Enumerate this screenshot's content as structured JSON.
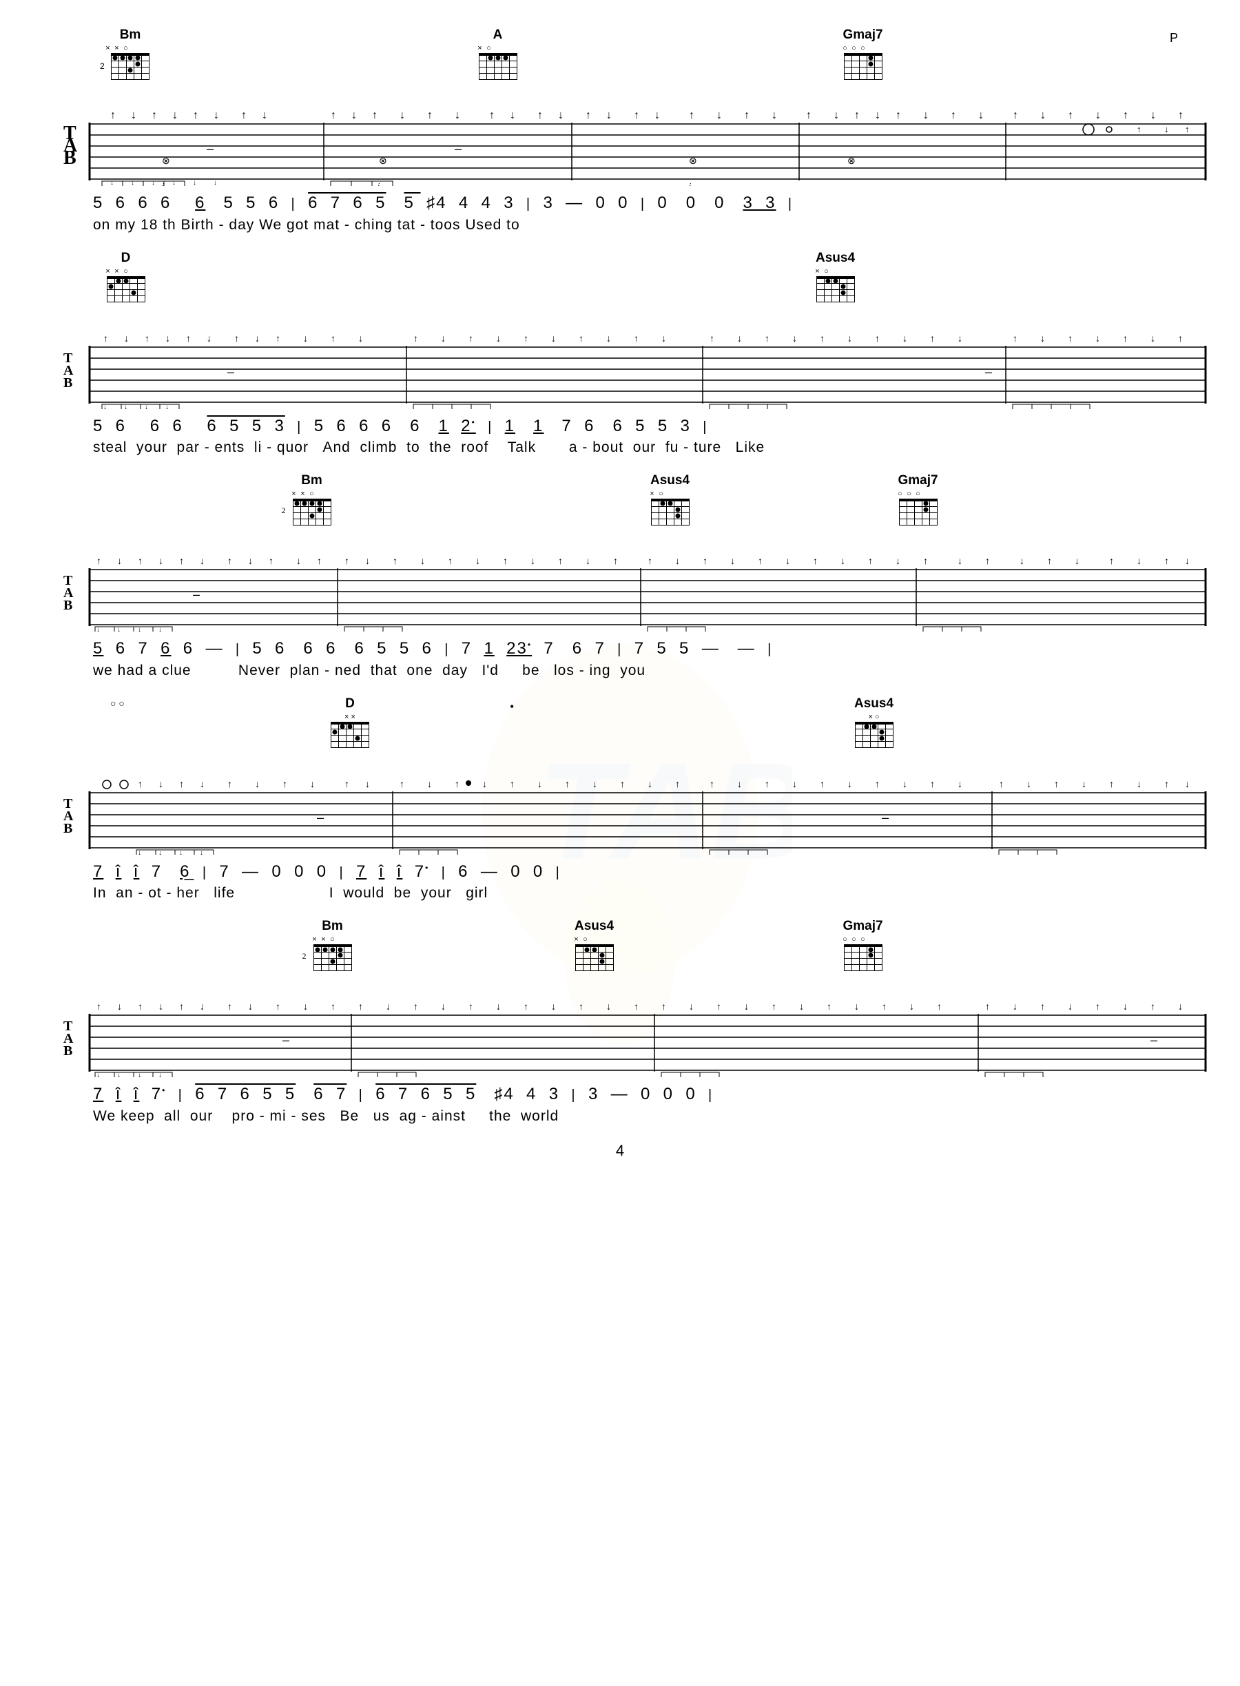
{
  "page": {
    "number": "4",
    "background_color": "#ffffff"
  },
  "sections": [
    {
      "id": "section1",
      "chords": [
        {
          "name": "Bm",
          "fret_label": "2",
          "left_pct": 5,
          "tops": [
            "x",
            "x",
            "o",
            "",
            "",
            ""
          ],
          "dots": [
            [
              1,
              1
            ],
            [
              2,
              3
            ],
            [
              3,
              2
            ]
          ]
        },
        {
          "name": "A",
          "fret_label": "",
          "left_pct": 36,
          "tops": [
            "x",
            "o",
            "",
            "",
            "",
            ""
          ],
          "dots": [
            [
              1,
              1
            ],
            [
              1,
              2
            ],
            [
              1,
              3
            ],
            [
              2,
              4
            ]
          ]
        },
        {
          "name": "Gmaj7",
          "fret_label": "",
          "left_pct": 67,
          "tops": [
            "o",
            "o",
            "o",
            "",
            "",
            ""
          ],
          "dots": [
            [
              1,
              5
            ],
            [
              2,
              5
            ]
          ]
        }
      ],
      "numbers": "5 6 6 6   6 5 5 6 | 6 7 6 5  5 ♯4 4  4  3 | 3  —  0  0 | 0   0   0  3̲ 3̲ |",
      "lyrics": "on my 18 th    Birth - day   We  got  mat - ching     tat - toos                         Used to"
    },
    {
      "id": "section2",
      "chords": [
        {
          "name": "D",
          "fret_label": "",
          "left_pct": 5,
          "tops": [
            "x",
            "x",
            "o",
            "",
            "",
            ""
          ],
          "dots": [
            [
              1,
              2
            ],
            [
              1,
              3
            ],
            [
              2,
              1
            ]
          ]
        },
        {
          "name": "Asus4",
          "fret_label": "",
          "left_pct": 70,
          "tops": [
            "x",
            "o",
            "",
            "",
            "",
            ""
          ],
          "dots": [
            [
              1,
              1
            ],
            [
              1,
              2
            ],
            [
              2,
              3
            ],
            [
              3,
              3
            ]
          ]
        }
      ],
      "numbers": "5  6   6  6    6  5  5 3 | 5  6  6 6  6   1̲ 2̲• | 1̲  1̲  7  6   6  5  5 3 |",
      "lyrics": "steal  your  par - ents  li - quor  And  climb  to  the  roof   Talk     a - bout  our  fu - ture   Like"
    },
    {
      "id": "section3",
      "chords": [
        {
          "name": "Bm",
          "fret_label": "2",
          "left_pct": 22,
          "tops": [
            "x",
            "x",
            "o",
            "",
            "",
            ""
          ],
          "dots": [
            [
              1,
              1
            ],
            [
              2,
              3
            ],
            [
              3,
              2
            ]
          ]
        },
        {
          "name": "Asus4",
          "fret_label": "",
          "left_pct": 55,
          "tops": [
            "x",
            "o",
            "",
            "",
            "",
            ""
          ],
          "dots": [
            [
              1,
              1
            ],
            [
              1,
              2
            ],
            [
              2,
              3
            ],
            [
              3,
              3
            ]
          ]
        },
        {
          "name": "Gmaj7",
          "fret_label": "",
          "left_pct": 78,
          "tops": [
            "o",
            "o",
            "o",
            "",
            "",
            ""
          ],
          "dots": [
            [
              1,
              5
            ],
            [
              2,
              5
            ]
          ]
        }
      ],
      "numbers": "5̲  6  7  6̲  6  —  | 5  6   6  6  6  5  5  6 | 7  1̲  2̲3̲•  7   6  7 | 7  5  5  —   — |",
      "lyrics": "we had a clue          Never  plan - ned  that  one  day   I'd    be   los - ing  you"
    },
    {
      "id": "section4",
      "chords": [
        {
          "name": "D",
          "fret_label": "",
          "left_pct": 26,
          "tops": [
            "x",
            "x",
            "o",
            "",
            "",
            ""
          ],
          "dots": [
            [
              1,
              2
            ],
            [
              1,
              3
            ],
            [
              2,
              1
            ]
          ]
        },
        {
          "name": "Asus4",
          "fret_label": "",
          "left_pct": 73,
          "tops": [
            "x",
            "o",
            "",
            "",
            "",
            ""
          ],
          "dots": [
            [
              1,
              1
            ],
            [
              1,
              2
            ],
            [
              2,
              3
            ],
            [
              3,
              3
            ]
          ]
        }
      ],
      "numbers": "7̲  1̲  1̲  7   6̲ | 7  —  0  0  0 | 7̲  1̲  1̲   7•  | 6  —  0  0  |",
      "lyrics": "In  an - ot - her   life                  I  would  be  your   girl"
    },
    {
      "id": "section5",
      "chords": [
        {
          "name": "Bm",
          "fret_label": "2",
          "left_pct": 24,
          "tops": [
            "x",
            "x",
            "o",
            "",
            "",
            ""
          ],
          "dots": [
            [
              1,
              1
            ],
            [
              2,
              3
            ],
            [
              3,
              2
            ]
          ]
        },
        {
          "name": "Asus4",
          "fret_label": "",
          "left_pct": 49,
          "tops": [
            "x",
            "o",
            "",
            "",
            "",
            ""
          ],
          "dots": [
            [
              1,
              1
            ],
            [
              1,
              2
            ],
            [
              2,
              3
            ],
            [
              3,
              3
            ]
          ]
        },
        {
          "name": "Gmaj7",
          "fret_label": "",
          "left_pct": 72,
          "tops": [
            "o",
            "o",
            "o",
            "",
            "",
            ""
          ],
          "dots": [
            [
              1,
              5
            ],
            [
              2,
              5
            ]
          ]
        }
      ],
      "numbers": "7̲  1̲  1̲  7•  | 6  7  6  5  5   6  7 | 6  7  6  5  5  ♯4  4  3 | 3  —  0  0  0 |",
      "lyrics": "We keep  all  our    pro - mi - ses   Be   us   ag - ainst    the  world"
    }
  ]
}
